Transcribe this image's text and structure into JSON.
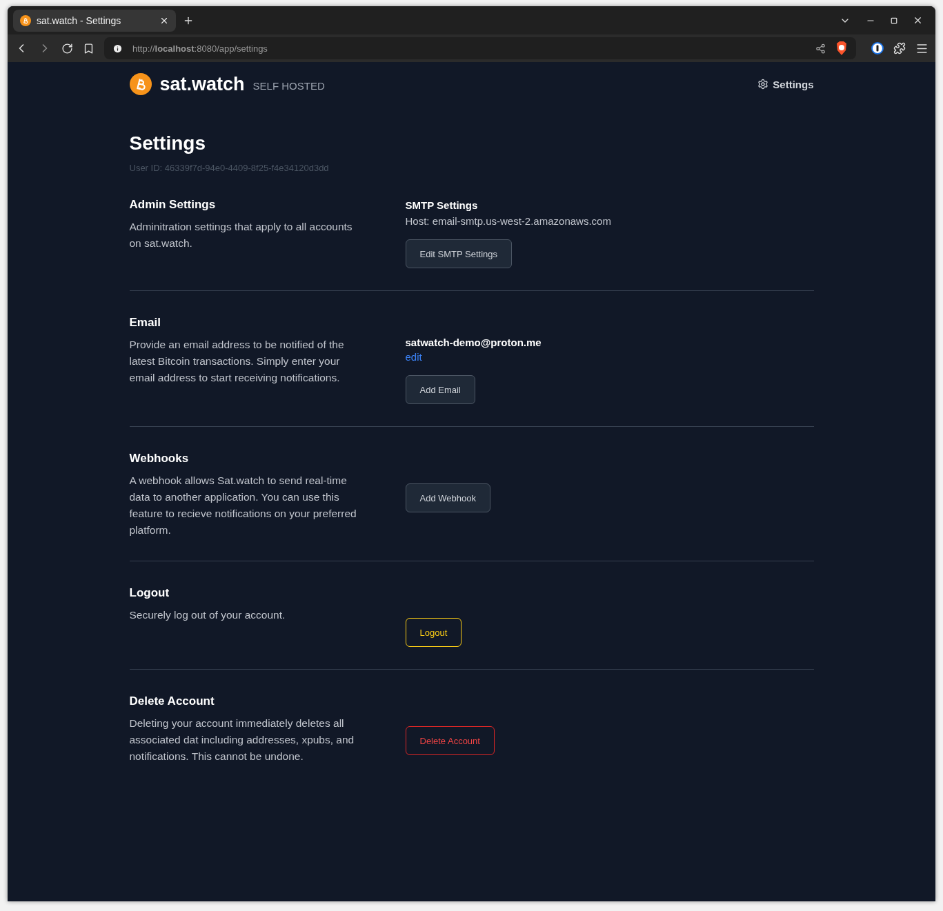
{
  "browser": {
    "tab_title": "sat.watch - Settings",
    "url": "http://**localhost**:8080/app/settings"
  },
  "header": {
    "brand": "sat.watch",
    "tagline": "SELF HOSTED",
    "nav_link": "Settings"
  },
  "page": {
    "title": "Settings",
    "user_id": "User ID: 46339f7d-94e0-4409-8f25-f4e34120d3dd"
  },
  "sections": [
    {
      "kind": "admin",
      "title": "Admin Settings",
      "description": "Adminitration settings that apply to all accounts on sat.watch.",
      "subtitle": "SMTP Settings",
      "detail": "Host: email-smtp.us-west-2.amazonaws.com",
      "button": "Edit SMTP Settings"
    },
    {
      "kind": "email",
      "title": "Email",
      "description": "Provide an email address to be notified of the latest Bitcoin transactions. Simply enter your email address to start receiving notifications.",
      "email": "satwatch-demo@proton.me",
      "link": "edit",
      "button": "Add Email"
    },
    {
      "kind": "plain",
      "title": "Webhooks",
      "description": "A webhook allows Sat.watch to send real-time data to another application. You can use this feature to recieve notifications on your preferred platform.",
      "button": "Add Webhook"
    },
    {
      "kind": "logout",
      "title": "Logout",
      "description": "Securely log out of your account.",
      "button": "Logout"
    },
    {
      "kind": "delete",
      "title": "Delete Account",
      "description": "Deleting your account immediately deletes all associated dat including addresses, xpubs, and notifications. This cannot be undone.",
      "button": "Delete Account"
    }
  ]
}
